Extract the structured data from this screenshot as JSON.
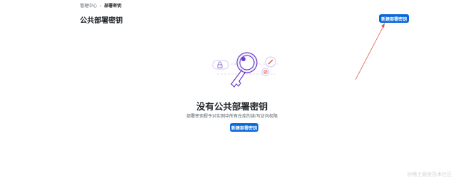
{
  "breadcrumb": {
    "parent": "管理中心",
    "separator": "›",
    "current": "部署密钥"
  },
  "header": {
    "title": "公共部署密钥",
    "new_key_button": "新建部署密钥"
  },
  "empty_state": {
    "title": "没有公共部署密钥",
    "description": "部署密钥授予对实例中所有仓库的读/写访问权限",
    "new_key_button": "新建部署密钥"
  },
  "icons": [
    "key-illustration",
    "lock-icon",
    "pencil-icon",
    "no-entry-icon",
    "annotation-arrow"
  ],
  "colors": {
    "primary": "#0969da",
    "illustration_purple": "#6e40c9",
    "annotation_red": "#e5534b"
  },
  "watermark": "@稀土掘金技术社区"
}
